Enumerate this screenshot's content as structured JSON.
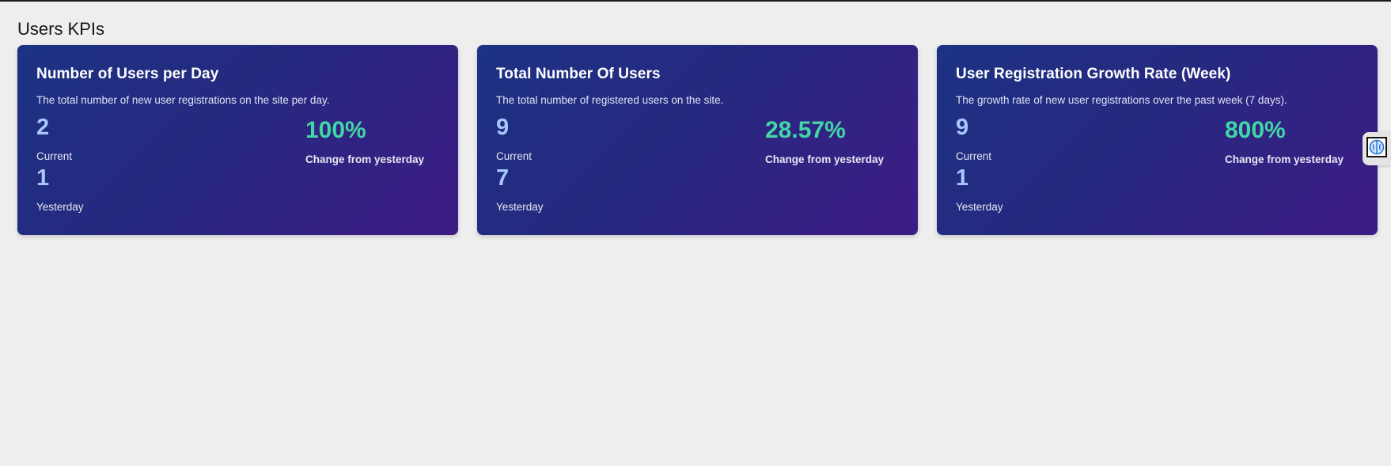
{
  "page": {
    "title": "Users KPIs"
  },
  "cards": [
    {
      "title": "Number of Users per Day",
      "description": "The total number of new user registrations on the site per day.",
      "current_value": "2",
      "current_label": "Current",
      "yesterday_value": "1",
      "yesterday_label": "Yesterday",
      "change_value": "100%",
      "change_label": "Change from yesterday"
    },
    {
      "title": "Total Number Of Users",
      "description": "The total number of registered users on the site.",
      "current_value": "9",
      "current_label": "Current",
      "yesterday_value": "7",
      "yesterday_label": "Yesterday",
      "change_value": "28.57%",
      "change_label": "Change from yesterday"
    },
    {
      "title": "User Registration Growth Rate (Week)",
      "description": "The growth rate of new user registrations over the past week (7 days).",
      "current_value": "9",
      "current_label": "Current",
      "yesterday_value": "1",
      "yesterday_label": "Yesterday",
      "change_value": "800%",
      "change_label": "Change from yesterday"
    }
  ],
  "side_widget": {
    "icon": "brain-icon"
  },
  "colors": {
    "background": "#eeeeee",
    "card_gradient_start": "#1c3283",
    "card_gradient_end": "#3e1b86",
    "value_color": "#a9c7ff",
    "change_color": "#43d6a5"
  }
}
